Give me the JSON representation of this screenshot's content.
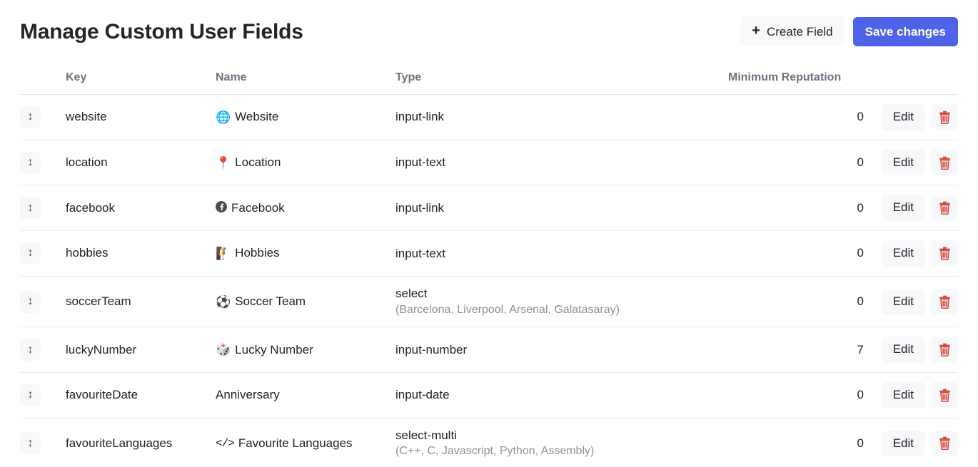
{
  "header": {
    "title": "Manage Custom User Fields",
    "create_button": {
      "label": "Create Field",
      "icon": "plus-icon",
      "glyph": "+"
    },
    "save_button": {
      "label": "Save changes",
      "color": "#4f63e8"
    }
  },
  "table": {
    "columns": {
      "drag": "",
      "key": "Key",
      "name": "Name",
      "type": "Type",
      "reputation": "Minimum Reputation",
      "actions": ""
    },
    "row_actions": {
      "edit_label": "Edit",
      "delete_icon": "trash-icon",
      "drag_icon": "updown-arrow-icon",
      "drag_glyph": "↕",
      "delete_color": "#d9453d"
    },
    "rows": [
      {
        "key": "website",
        "name": "Website",
        "name_icon": "globe-icon",
        "name_glyph": "🌐",
        "type": "input-link",
        "options": "",
        "reputation": "0"
      },
      {
        "key": "location",
        "name": "Location",
        "name_icon": "pushpin-icon",
        "name_glyph": "📍",
        "type": "input-text",
        "options": "",
        "reputation": "0"
      },
      {
        "key": "facebook",
        "name": "Facebook",
        "name_icon": "facebook-icon",
        "name_glyph": "",
        "type": "input-link",
        "options": "",
        "reputation": "0"
      },
      {
        "key": "hobbies",
        "name": "Hobbies",
        "name_icon": "hiking-person-icon",
        "name_glyph": "🧗",
        "type": "input-text",
        "options": "",
        "reputation": "0"
      },
      {
        "key": "soccerTeam",
        "name": "Soccer Team",
        "name_icon": "soccer-ball-icon",
        "name_glyph": "⚽",
        "type": "select",
        "options": "(Barcelona, Liverpool, Arsenal, Galatasaray)",
        "reputation": "0"
      },
      {
        "key": "luckyNumber",
        "name": "Lucky Number",
        "name_icon": "dice-icon",
        "name_glyph": "🎲",
        "type": "input-number",
        "options": "",
        "reputation": "7"
      },
      {
        "key": "favouriteDate",
        "name": "Anniversary",
        "name_icon": "",
        "name_glyph": "",
        "type": "input-date",
        "options": "",
        "reputation": "0"
      },
      {
        "key": "favouriteLanguages",
        "name": "Favourite Languages",
        "name_icon": "code-brackets-icon",
        "name_glyph": "</>",
        "type": "select-multi",
        "options": "(C++, C, Javascript, Python, Assembly)",
        "reputation": "0"
      }
    ]
  }
}
